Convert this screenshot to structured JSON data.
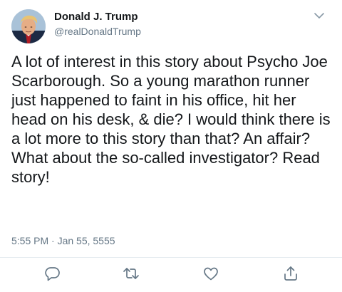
{
  "tweet": {
    "author_name": "Donald J. Trump",
    "author_handle": "@realDonaldTrump",
    "text": "A lot of interest in this story about Psycho Joe Scarborough. So a young marathon runner just happened to faint in his office, hit her head on his desk, & die? I would think there is a lot more to this story than that? An affair? What about the so-called investigator? Read story!",
    "timestamp": "5:55 PM · Jan 55, 5555"
  },
  "icons": {
    "avatar": "profile-photo",
    "menu": "chevron-down-icon",
    "reply": "reply-icon",
    "retweet": "retweet-icon",
    "like": "heart-icon",
    "share": "share-icon"
  },
  "colors": {
    "text": "#14171a",
    "secondary": "#657786",
    "icon": "#657786",
    "divider": "#e6ecf0"
  }
}
